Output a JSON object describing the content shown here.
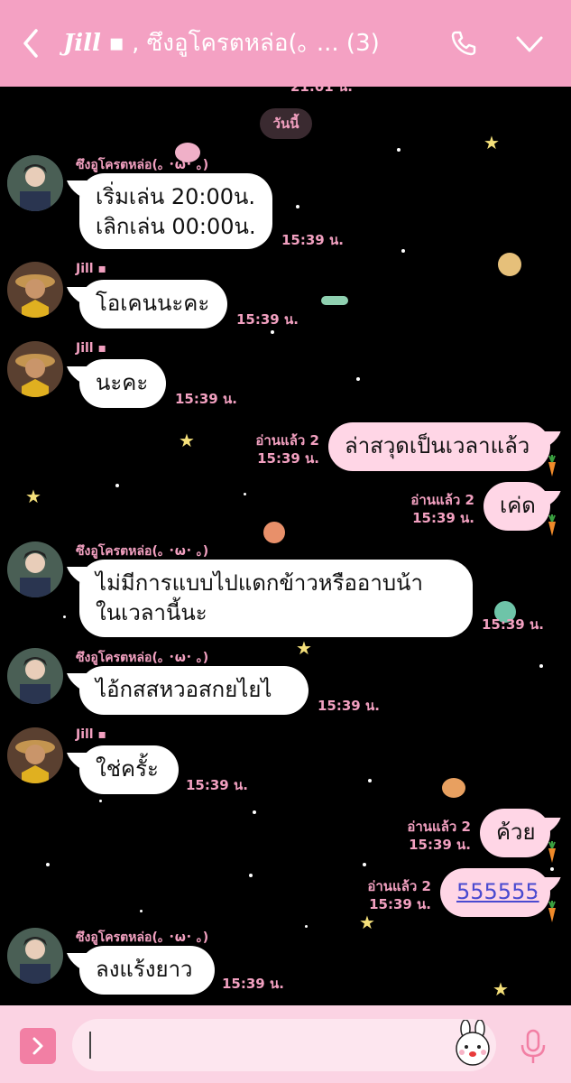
{
  "header": {
    "back_icon": "chevron-left-icon",
    "title_sig": "Jill",
    "title_rest": " ▪ , ซึงอูโครตหล่อ(｡ ... (3)",
    "phone_icon": "phone-icon",
    "dropdown_icon": "chevron-down-icon",
    "color": "#f4a1c3"
  },
  "prev_time": "21:01 น.",
  "day_label": "วันนี้",
  "messages": [
    {
      "sender": "ซึงอูโครตหล่อ(｡ ･ω･ ｡)",
      "text": "เริ่มเล่น 20:00น.\nเลิกเล่น 00:00น.",
      "time": "15:39 น."
    },
    {
      "sender": "Jill ▪",
      "text": "โอเคนนะคะ",
      "time": "15:39 น."
    },
    {
      "sender": "Jill ▪",
      "text": "นะคะ",
      "time": "15:39 น."
    },
    {
      "read": "อ่านแล้ว 2",
      "text": "ล่าสวุดเป็นเวลาแล้ว",
      "time": "15:39 น."
    },
    {
      "read": "อ่านแล้ว 2",
      "text": "เค่ด",
      "time": "15:39 น."
    },
    {
      "sender": "ซึงอูโครตหล่อ(｡ ･ω･ ｡)",
      "text": "ไม่มีการแบบไปแดกข้าวหรืออาบน้า\nในเวลานี้นะ",
      "time": "15:39 น."
    },
    {
      "sender": "ซึงอูโครตหล่อ(｡ ･ω･ ｡)",
      "text": "ไอ้กสสหวอสกยไยไ",
      "time": "15:39 น."
    },
    {
      "sender": "Jill ▪",
      "text": "ใช่ครั้ะ",
      "time": "15:39 น."
    },
    {
      "read": "อ่านแล้ว 2",
      "text": "ค้วย",
      "time": "15:39 น."
    },
    {
      "read": "อ่านแล้ว 2",
      "text": "555555",
      "time": "15:39 น."
    },
    {
      "sender": "ซึงอูโครตหล่อ(｡ ･ω･ ｡)",
      "text": "ลงแร้งยาว",
      "time": "15:39 น."
    }
  ],
  "footer": {
    "expand_icon": "chevron-right-icon",
    "sticker_icon": "sticker-icon",
    "mic_icon": "microphone-icon",
    "input_value": "",
    "color": "#fbd3e3"
  }
}
